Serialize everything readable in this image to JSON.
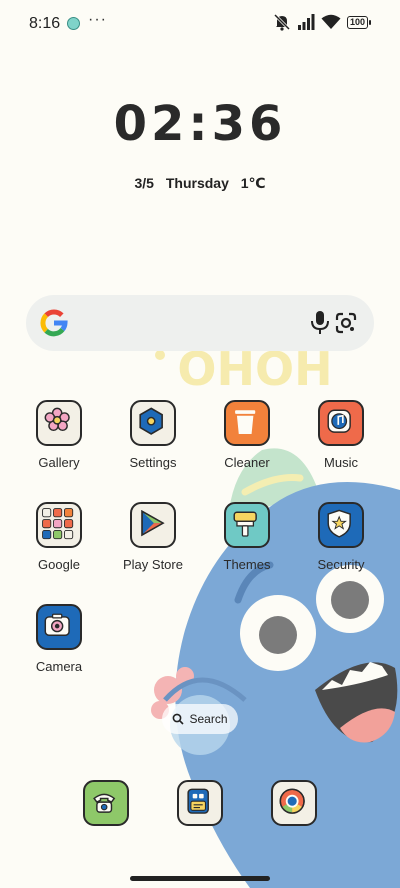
{
  "status_bar": {
    "time": "8:16",
    "overflow": "···",
    "battery": "100",
    "icons": [
      "app-notification-icon",
      "mute-icon",
      "signal-icon",
      "wifi-icon",
      "battery-icon"
    ]
  },
  "clock_widget": {
    "time": "02:36",
    "date": "3/5",
    "weekday": "Thursday",
    "temperature": "1℃"
  },
  "search_bar": {
    "icons": [
      "google-logo-icon",
      "microphone-icon",
      "google-lens-icon"
    ]
  },
  "wallpaper": {
    "text": "OHOH",
    "colors": {
      "background": "#fdfcf6",
      "monster": "#7ca8d6",
      "text": "#f6ebae"
    }
  },
  "apps": [
    {
      "label": "Gallery",
      "icon": "flower-icon",
      "color": "#f3f0e6"
    },
    {
      "label": "Settings",
      "icon": "hexagon-nut-icon",
      "color": "#f3f0e6"
    },
    {
      "label": "Cleaner",
      "icon": "trash-can-icon",
      "color": "#f2823b"
    },
    {
      "label": "Music",
      "icon": "music-note-icon",
      "color": "#ef6a4a"
    },
    {
      "label": "Google",
      "icon": "app-folder-icon",
      "color": "#f3f0e6"
    },
    {
      "label": "Play Store",
      "icon": "play-triangle-icon",
      "color": "#f3f0e6"
    },
    {
      "label": "Themes",
      "icon": "paint-roller-icon",
      "color": "#6fc9c5"
    },
    {
      "label": "Security",
      "icon": "shield-icon",
      "color": "#1e6ab8"
    },
    {
      "label": "Camera",
      "icon": "camera-icon",
      "color": "#1e6ab8"
    }
  ],
  "mini_search": {
    "label": "Search"
  },
  "dock": [
    {
      "icon": "telephone-icon",
      "color": "#8ec869"
    },
    {
      "icon": "messages-icon",
      "color": "#f3f0e6"
    },
    {
      "icon": "chrome-icon",
      "color": "#f3f0e6"
    }
  ]
}
